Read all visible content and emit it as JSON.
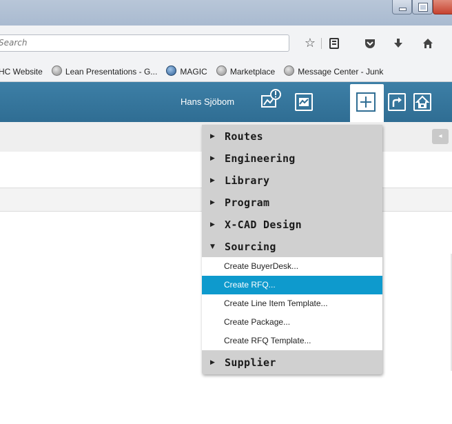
{
  "browser": {
    "search_placeholder": "Search",
    "toolbar_icons": [
      "star-icon",
      "reading-list-icon",
      "pocket-icon",
      "download-icon",
      "home-icon"
    ]
  },
  "bookmarks": [
    {
      "label": "HC Website",
      "icon": "none"
    },
    {
      "label": "Lean Presentations - G...",
      "icon": "globe-icon"
    },
    {
      "label": "MAGIC",
      "icon": "magic-icon"
    },
    {
      "label": "Marketplace",
      "icon": "globe-icon"
    },
    {
      "label": "Message Center - Junk",
      "icon": "globe-icon"
    }
  ],
  "header": {
    "username": "Hans Sjöbom",
    "icons": [
      "notification-icon",
      "chart-icon",
      "plus-icon",
      "share-icon",
      "home-icon"
    ]
  },
  "menu": {
    "categories": [
      {
        "label": "Routes",
        "expanded": false
      },
      {
        "label": "Engineering",
        "expanded": false
      },
      {
        "label": "Library",
        "expanded": false
      },
      {
        "label": "Program",
        "expanded": false
      },
      {
        "label": "X-CAD Design",
        "expanded": false
      },
      {
        "label": "Sourcing",
        "expanded": true
      },
      {
        "label": "Supplier",
        "expanded": false
      }
    ],
    "sourcing_items": [
      {
        "label": "Create BuyerDesk...",
        "selected": false
      },
      {
        "label": "Create RFQ...",
        "selected": true
      },
      {
        "label": "Create Line Item Template...",
        "selected": false
      },
      {
        "label": "Create Package...",
        "selected": false
      },
      {
        "label": "Create RFQ Template...",
        "selected": false
      }
    ],
    "selected_color": "#0e9acd"
  }
}
